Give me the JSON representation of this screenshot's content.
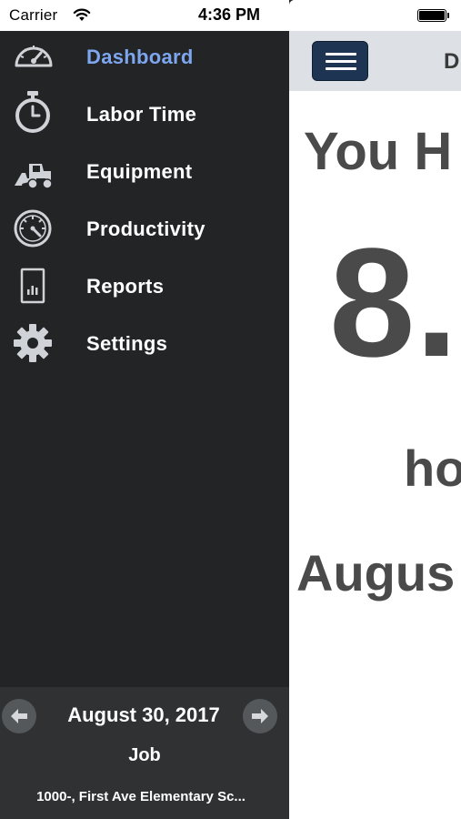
{
  "status_bar": {
    "carrier": "Carrier",
    "time": "4:36 PM"
  },
  "sidebar": {
    "items": [
      {
        "label": "Dashboard",
        "icon": "speedometer-icon",
        "active": true
      },
      {
        "label": "Labor Time",
        "icon": "stopwatch-icon",
        "active": false
      },
      {
        "label": "Equipment",
        "icon": "loader-icon",
        "active": false
      },
      {
        "label": "Productivity",
        "icon": "gauge-icon",
        "active": false
      },
      {
        "label": "Reports",
        "icon": "report-chart-icon",
        "active": false
      },
      {
        "label": "Settings",
        "icon": "gear-icon",
        "active": false
      }
    ],
    "footer": {
      "date": "August 30, 2017",
      "job_label": "Job",
      "job_site": "1000-, First Ave Elementary Sc..."
    }
  },
  "main": {
    "topbar_title": "D",
    "heading": "You H",
    "hours": "8.",
    "unit": "ho",
    "date": "Augus"
  },
  "colors": {
    "sidebar_bg": "#222426",
    "active_item": "#7ea6ef",
    "menu_button": "#1d3552"
  }
}
